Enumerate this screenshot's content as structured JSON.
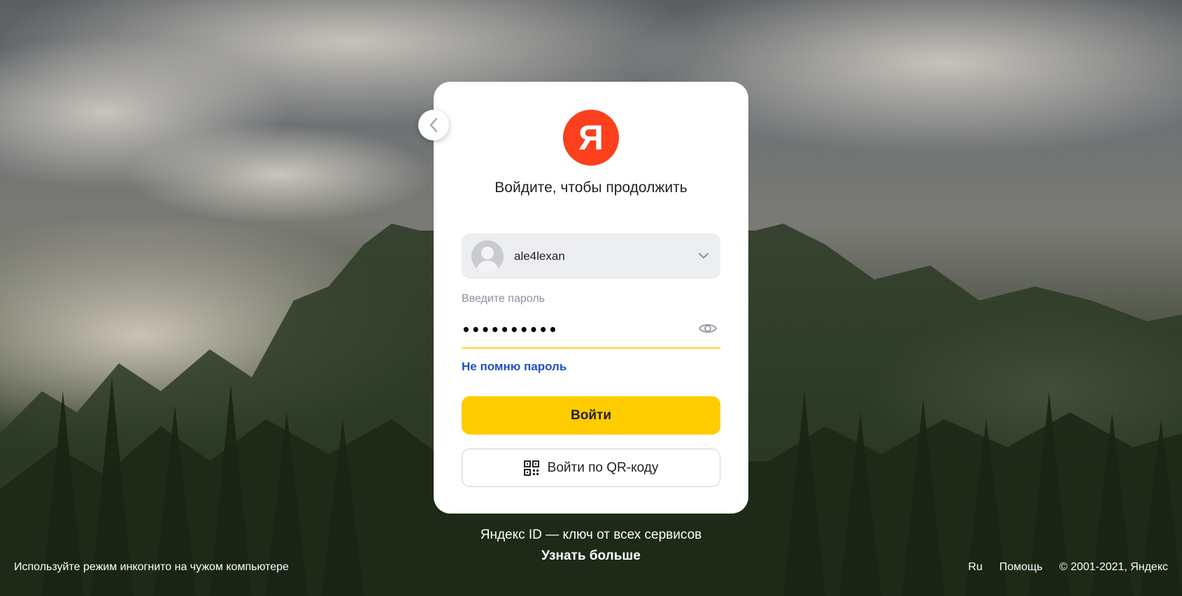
{
  "card": {
    "logo_letter": "Я",
    "title": "Войдите, чтобы продолжить",
    "account": {
      "login": "ale4lexan"
    },
    "password": {
      "label": "Введите пароль",
      "value": "••••••••••"
    },
    "forgot_link": "Не помню пароль",
    "login_button": "Войти",
    "qr_button": "Войти по QR-коду"
  },
  "promo": {
    "tagline": "Яндекс ID — ключ от всех сервисов",
    "learn_more": "Узнать больше"
  },
  "footer": {
    "incognito_hint": "Используйте режим инкогнито на чужом компьютере",
    "language": "Ru",
    "help": "Помощь",
    "copyright": "© 2001-2021, Яндекс"
  },
  "colors": {
    "brand_red": "#fc3f1d",
    "accent_yellow": "#ffcc00",
    "link_blue": "#1f51c4"
  },
  "icons": {
    "back": "chevron-left-icon",
    "dropdown": "chevron-down-icon",
    "show_password": "eye-icon",
    "qr": "qr-code-icon",
    "avatar": "user-avatar-icon"
  }
}
